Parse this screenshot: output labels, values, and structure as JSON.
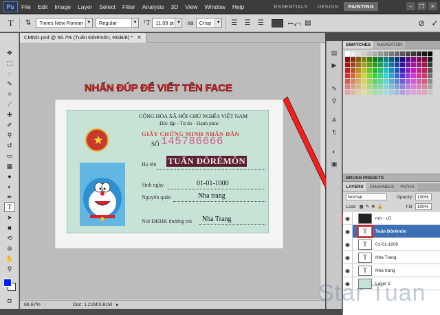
{
  "menubar": {
    "app_logo": "Ps",
    "items": [
      "File",
      "Edit",
      "Image",
      "Layer",
      "Select",
      "Filter",
      "Analysis",
      "3D",
      "View",
      "Window",
      "Help"
    ],
    "workspaces": [
      "ESSENTIALS",
      "DESIGN",
      "PAINTING"
    ],
    "active_workspace": "PAINTING"
  },
  "options": {
    "font_family": "Times New Roman",
    "font_style": "Regular",
    "font_size": "11,09 pt",
    "anti_alias": "Crisp"
  },
  "document": {
    "tab_title": "CMND.psd @ 66.7% (Tuấn Đôrêmôn, RGB/8) *",
    "zoom": "66.67%",
    "doc_size": "Doc: 1.21M/3.81M"
  },
  "card": {
    "header1": "CỘNG HÒA XÃ HỘI CHỦ NGHĨA VIỆT NAM",
    "header2": "Độc lập - Tự do - Hạnh phúc",
    "title": "GIẤY CHỨNG MINH NHÂN DÂN",
    "so_label": "SỐ",
    "number": "145786666",
    "name_label": "Họ tên",
    "name_value": "TUẤN ĐÔRÊMÔN",
    "dob_label": "Sinh ngày",
    "dob_value": "01-01-1000",
    "origin_label": "Nguyên quán",
    "origin_value": "Nha trang",
    "residence_label": "Nơi ĐKHK thường trú",
    "residence_value": "Nha Trang"
  },
  "annotation": {
    "text": "NHẤN ĐÚP ĐỂ VIẾT TÊN FACE",
    "color": "#ff1a1a"
  },
  "panels": {
    "swatches_tab": "SWATCHES",
    "navigator_tab": "NAVIGATOR",
    "brush_presets": "BRUSH PRESETS",
    "layers_tab": "LAYERS",
    "channels_tab": "CHANNELS",
    "paths_tab": "PATHS",
    "blend_mode": "Normal",
    "opacity_label": "Opacity:",
    "opacity_value": "100%",
    "lock_label": "Lock:",
    "fill_label": "Fill:",
    "fill_value": "100%"
  },
  "layers": [
    {
      "name": "mờ - cũ",
      "type": "image"
    },
    {
      "name": "Tuấn Đôrêmôn",
      "type": "text",
      "selected": true
    },
    {
      "name": "01-01-1000",
      "type": "text"
    },
    {
      "name": "Nha Trang",
      "type": "text"
    },
    {
      "name": "Nha trang",
      "type": "text"
    },
    {
      "name": "Layer 1",
      "type": "image"
    }
  ],
  "watermark": "Star Tuan",
  "colors": {
    "foreground": "#0020ff",
    "background": "#ffffff",
    "selection": "#3b6fb6"
  }
}
